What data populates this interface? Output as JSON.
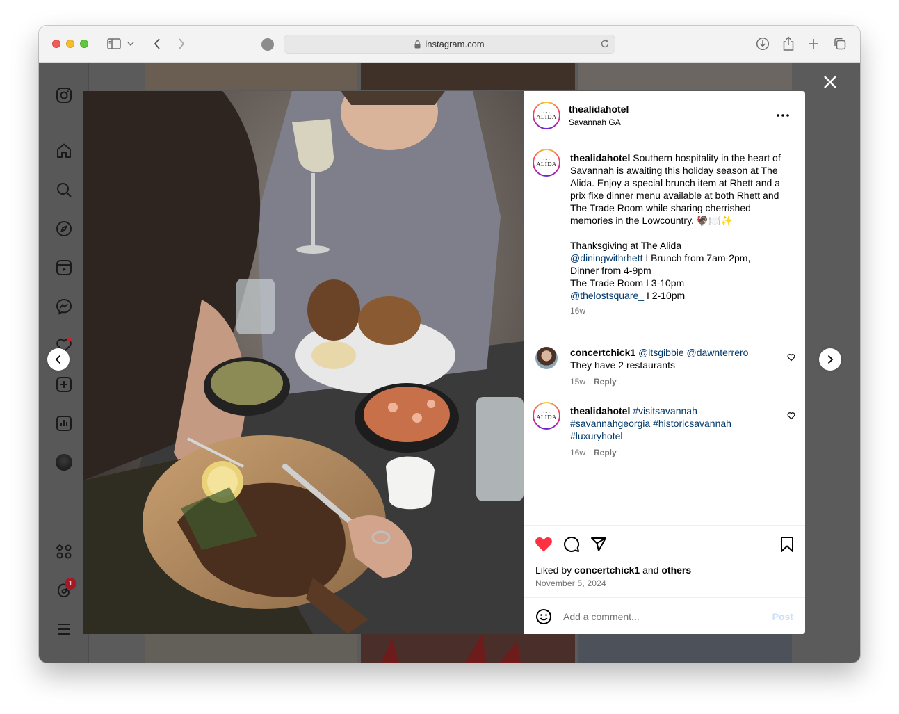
{
  "browser": {
    "url": "instagram.com"
  },
  "post": {
    "username": "thealidahotel",
    "location": "Savannah GA",
    "avatar_text": "ALIDA",
    "caption_username": "thealidahotel",
    "caption_text": "Southern hospitality in the heart of Savannah is awaiting this holiday season at The Alida. Enjoy a special brunch item at Rhett and a prix fixe dinner menu available at both Rhett and The Trade Room while sharing cherrished memories in the Lowcountry. 🦃🍽️✨",
    "caption_line1": "Thanksgiving at The Alida",
    "caption_mention1": "@diningwithrhett",
    "caption_line2": " I Brunch from 7am-2pm,",
    "caption_line3": "Dinner from 4-9pm",
    "caption_line4": "The Trade Room I 3-10pm",
    "caption_mention2": "@thelostsquare_",
    "caption_line5": " I 2-10pm",
    "caption_age": "16w",
    "likes_prefix": "Liked by ",
    "likes_user": "concertchick1",
    "likes_mid": " and ",
    "likes_others": "others",
    "date": "November 5, 2024",
    "add_comment_placeholder": "Add a comment...",
    "post_button": "Post"
  },
  "comments": [
    {
      "username": "concertchick1",
      "mentions": "@itsgibbie @dawnterrero",
      "text": "They have 2 restaurants",
      "age": "15w",
      "reply": "Reply"
    },
    {
      "username": "thealidahotel",
      "tags": "#visitsavannah #savannahgeorgia #historicsavannah #luxuryhotel",
      "age": "16w",
      "reply": "Reply"
    }
  ],
  "sidebar": {
    "notification_badge": "1"
  },
  "colors": {
    "like_red": "#ff3040",
    "link_blue": "#00376b",
    "post_disabled": "#c7e0fd"
  },
  "icons": [
    "instagram-icon",
    "home-icon",
    "search-icon",
    "explore-icon",
    "reels-icon",
    "messenger-icon",
    "notifications-icon",
    "create-icon",
    "insights-icon",
    "profile-icon",
    "apps-icon",
    "threads-icon",
    "menu-icon"
  ]
}
